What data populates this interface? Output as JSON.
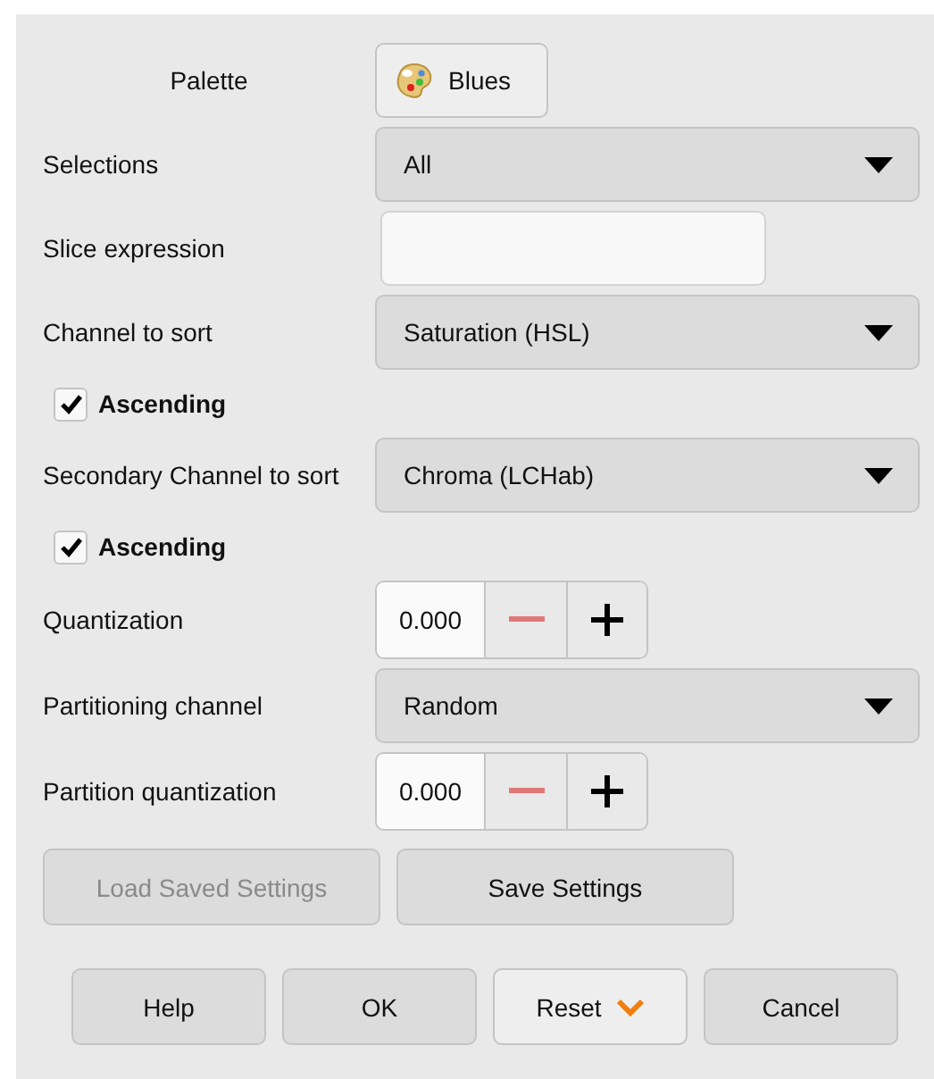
{
  "rows": [
    {
      "kind": "palette",
      "label": "Palette",
      "value": "Blues"
    },
    {
      "kind": "dropdown",
      "label": "Selections",
      "value": "All"
    },
    {
      "kind": "text",
      "label": "Slice expression"
    },
    {
      "kind": "dropdown",
      "label": "Channel to sort",
      "value": "Saturation (HSL)"
    },
    {
      "kind": "checkbox",
      "label": "Ascending",
      "checked": true
    },
    {
      "kind": "dropdown",
      "label": "Secondary Channel to sort",
      "value": "Chroma (LCHab)"
    },
    {
      "kind": "checkbox",
      "label": "Ascending",
      "checked": true
    },
    {
      "kind": "spin",
      "label": "Quantization",
      "value": "0.000",
      "minus_disabled": true
    },
    {
      "kind": "dropdown",
      "label": "Partitioning channel",
      "value": "Random"
    },
    {
      "kind": "spin",
      "label": "Partition quantization",
      "value": "0.000",
      "minus_disabled": true
    }
  ],
  "settings_buttons": [
    {
      "label": "Load Saved Settings",
      "disabled": true
    },
    {
      "label": "Save Settings",
      "disabled": false
    }
  ],
  "dialog_buttons": [
    {
      "label": "Help",
      "kind": "plain"
    },
    {
      "label": "OK",
      "kind": "plain"
    },
    {
      "label": "Reset",
      "kind": "menu"
    },
    {
      "label": "Cancel",
      "kind": "plain"
    }
  ]
}
